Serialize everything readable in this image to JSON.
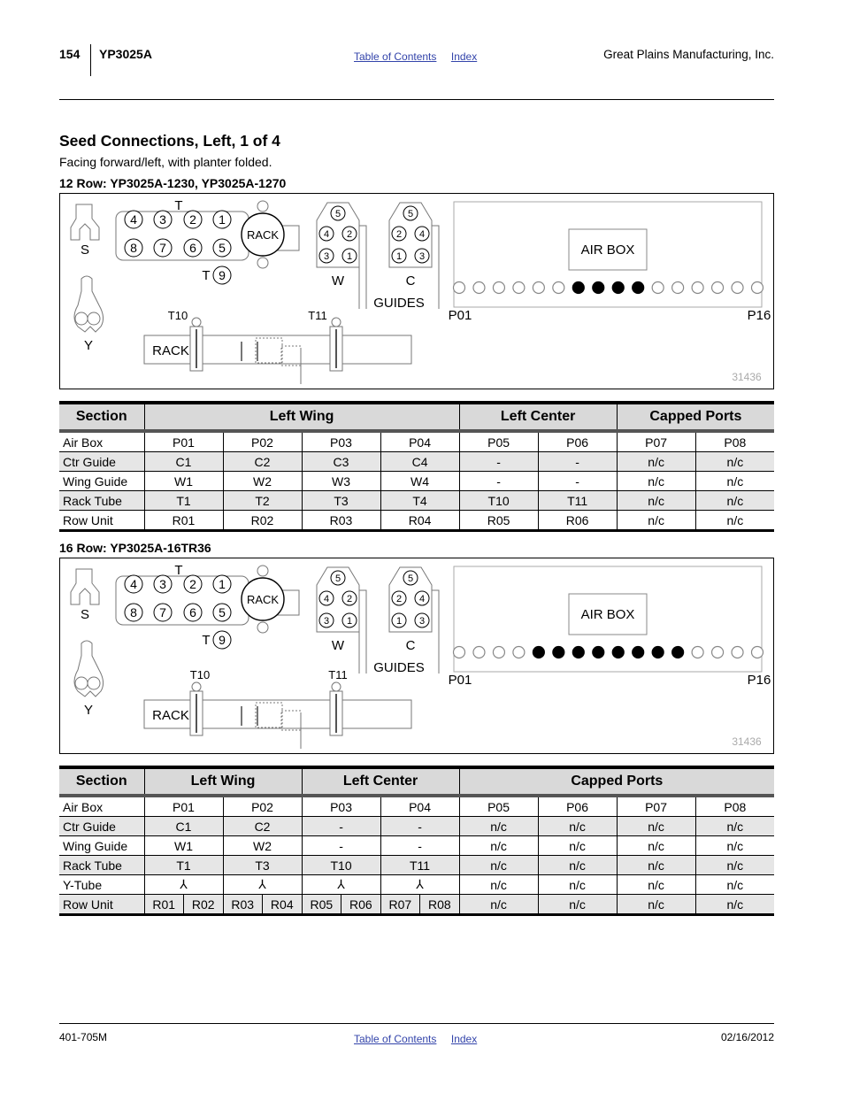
{
  "header": {
    "page_number": "154",
    "model": "YP3025A",
    "links": [
      "Table of Contents",
      "Index"
    ],
    "company": "Great Plains Manufacturing, Inc."
  },
  "page_title": "Seed Connections, Left, 1 of 4",
  "subtitle": "Facing forward/left, with planter folded.",
  "sections": [
    {
      "heading": "12 Row: YP3025A-1230, YP3025A-1270",
      "diagram": {
        "labels": {
          "s": "S",
          "y": "Y",
          "t_top": "T",
          "t9": "T",
          "rack_hub": "RACK",
          "w": "W",
          "c": "C",
          "guides": "GUIDES",
          "air_box": "AIR BOX",
          "p_first": "P01",
          "p_last": "P16",
          "t10": "T10",
          "t11": "T11",
          "rack_bar": "RACK",
          "figure_id": "31436"
        },
        "tube_top_row": [
          "4",
          "3",
          "2",
          "1"
        ],
        "tube_bottom_row": [
          "8",
          "7",
          "6",
          "5"
        ],
        "tube_extra": "9",
        "wing_guide_ports": [
          "5",
          "4",
          "2",
          "3",
          "1"
        ],
        "center_guide_ports": [
          "5",
          "2",
          "4",
          "1",
          "3"
        ],
        "air_box_port_count": 16,
        "filled_ports": [
          7,
          8,
          9,
          10
        ]
      },
      "table": {
        "headers": [
          {
            "label": "Section",
            "span": 1
          },
          {
            "label": "Left Wing",
            "span": 4
          },
          {
            "label": "Left Center",
            "span": 2
          },
          {
            "label": "Capped Ports",
            "span": 2
          }
        ],
        "rows": [
          {
            "label": "Air Box",
            "cells": [
              "P01",
              "P02",
              "P03",
              "P04",
              "P05",
              "P06",
              "P07",
              "P08"
            ]
          },
          {
            "label": "Ctr Guide",
            "cells": [
              "C1",
              "C2",
              "C3",
              "C4",
              "-",
              "-",
              "n/c",
              "n/c"
            ]
          },
          {
            "label": "Wing Guide",
            "cells": [
              "W1",
              "W2",
              "W3",
              "W4",
              "-",
              "-",
              "n/c",
              "n/c"
            ]
          },
          {
            "label": "Rack Tube",
            "cells": [
              "T1",
              "T2",
              "T3",
              "T4",
              "T10",
              "T11",
              "n/c",
              "n/c"
            ]
          },
          {
            "label": "Row Unit",
            "cells": [
              "R01",
              "R02",
              "R03",
              "R04",
              "R05",
              "R06",
              "n/c",
              "n/c"
            ]
          }
        ]
      }
    },
    {
      "heading": "16 Row: YP3025A-16TR36",
      "diagram": {
        "labels": {
          "s": "S",
          "y": "Y",
          "t_top": "T",
          "t9": "T",
          "rack_hub": "RACK",
          "w": "W",
          "c": "C",
          "guides": "GUIDES",
          "air_box": "AIR BOX",
          "p_first": "P01",
          "p_last": "P16",
          "t10": "T10",
          "t11": "T11",
          "rack_bar": "RACK",
          "figure_id": "31436"
        },
        "tube_top_row": [
          "4",
          "3",
          "2",
          "1"
        ],
        "tube_bottom_row": [
          "8",
          "7",
          "6",
          "5"
        ],
        "tube_extra": "9",
        "wing_guide_ports": [
          "5",
          "4",
          "2",
          "3",
          "1"
        ],
        "center_guide_ports": [
          "5",
          "2",
          "4",
          "1",
          "3"
        ],
        "air_box_port_count": 16,
        "filled_ports": [
          5,
          6,
          7,
          8,
          9,
          10,
          11,
          12
        ]
      },
      "table": {
        "headers": [
          {
            "label": "Section",
            "span": 1
          },
          {
            "label": "Left Wing",
            "span": 2
          },
          {
            "label": "Left Center",
            "span": 2
          },
          {
            "label": "Capped Ports",
            "span": 4
          }
        ],
        "rows": [
          {
            "label": "Air Box",
            "cells": [
              "P01",
              "P02",
              "P03",
              "P04",
              "P05",
              "P06",
              "P07",
              "P08"
            ]
          },
          {
            "label": "Ctr Guide",
            "cells": [
              "C1",
              "C2",
              "-",
              "-",
              "n/c",
              "n/c",
              "n/c",
              "n/c"
            ]
          },
          {
            "label": "Wing Guide",
            "cells": [
              "W1",
              "W2",
              "-",
              "-",
              "n/c",
              "n/c",
              "n/c",
              "n/c"
            ]
          },
          {
            "label": "Rack Tube",
            "cells": [
              "T1",
              "T3",
              "T10",
              "T11",
              "n/c",
              "n/c",
              "n/c",
              "n/c"
            ]
          },
          {
            "label": "Y-Tube",
            "cells": [
              "⅄",
              "⅄",
              "⅄",
              "⅄",
              "n/c",
              "n/c",
              "n/c",
              "n/c"
            ]
          },
          {
            "label": "Row Unit",
            "split_cells": [
              [
                "R01",
                "R02"
              ],
              [
                "R03",
                "R04"
              ],
              [
                "R05",
                "R06"
              ],
              [
                "R07",
                "R08"
              ]
            ],
            "cells": [
              "n/c",
              "n/c",
              "n/c",
              "n/c"
            ]
          }
        ]
      }
    }
  ],
  "footer": {
    "doc_number": "401-705M",
    "links": [
      "Table of Contents",
      "Index"
    ],
    "date": "02/16/2012"
  }
}
